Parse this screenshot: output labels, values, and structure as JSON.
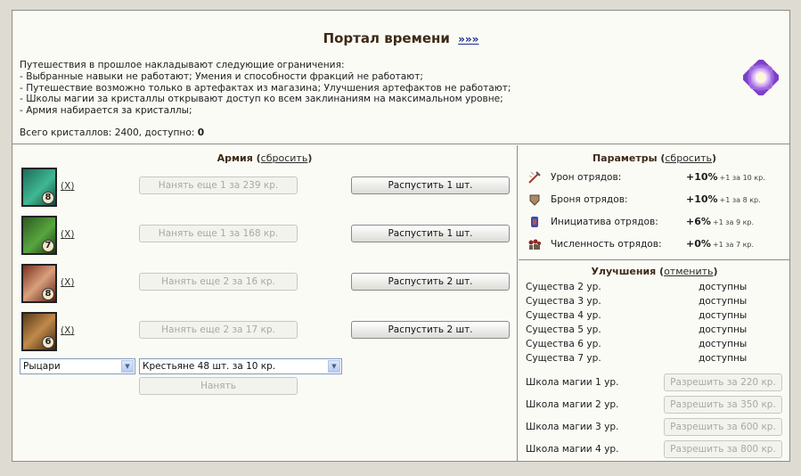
{
  "title": "Портал времени",
  "title_link": "»»»",
  "restrictions": [
    "Путешествия в прошлое накладывают следующие ограничения:",
    "- Выбранные навыки не работают; Умения и способности фракций не работают;",
    "- Путешествие возможно только в артефактах из магазина; Улучшения артефактов не работают;",
    "- Школы магии за кристаллы открывают доступ ко всем заклинаниям на максимальном уровне;",
    "- Армия набирается за кристаллы;"
  ],
  "crystals": {
    "label": "Всего кристаллов: 2400, доступно: ",
    "available": "0"
  },
  "army": {
    "title": "Армия",
    "reset_link": "сбросить",
    "units": [
      {
        "level": "8",
        "remove": "X",
        "hire_label": "Нанять еще 1 за 239 кр.",
        "dismiss_label": "Распустить 1 шт.",
        "icon": "green-dragon-icon"
      },
      {
        "level": "7",
        "remove": "X",
        "hire_label": "Нанять еще 1 за 168 кр.",
        "dismiss_label": "Распустить 1 шт.",
        "icon": "green-dragon-head-icon"
      },
      {
        "level": "8",
        "remove": "X",
        "hire_label": "Нанять еще 2 за 16 кр.",
        "dismiss_label": "Распустить 2 шт.",
        "icon": "elf-warrior-icon"
      },
      {
        "level": "6",
        "remove": "X",
        "hire_label": "Нанять еще 2 за 17 кр.",
        "dismiss_label": "Распустить 2 шт.",
        "icon": "centaur-icon"
      }
    ],
    "faction_select": "Рыцари",
    "unit_select": "Крестьяне 48 шт. за 10 кр.",
    "hire_button": "Нанять"
  },
  "parameters": {
    "title": "Параметры",
    "reset_link": "сбросить",
    "items": [
      {
        "label": "Урон отрядов:",
        "value": "+10%",
        "cost": "+1 за 10 кр.",
        "icon": "damage-icon"
      },
      {
        "label": "Броня отрядов:",
        "value": "+10%",
        "cost": "+1 за 8 кр.",
        "icon": "armor-icon"
      },
      {
        "label": "Инициатива отрядов:",
        "value": "+6%",
        "cost": "+1 за 9 кр.",
        "icon": "initiative-icon"
      },
      {
        "label": "Численность отрядов:",
        "value": "+0%",
        "cost": "+1 за 7 кр.",
        "icon": "troop-size-icon"
      }
    ]
  },
  "upgrades": {
    "title": "Улучшения",
    "cancel_link": "отменить",
    "creatures": [
      {
        "name": "Существа 2 ур.",
        "status": "доступны"
      },
      {
        "name": "Существа 3 ур.",
        "status": "доступны"
      },
      {
        "name": "Существа 4 ур.",
        "status": "доступны"
      },
      {
        "name": "Существа 5 ур.",
        "status": "доступны"
      },
      {
        "name": "Существа 6 ур.",
        "status": "доступны"
      },
      {
        "name": "Существа 7 ур.",
        "status": "доступны"
      }
    ],
    "magic": [
      {
        "name": "Школа магии 1 ур.",
        "button": "Разрешить за 220 кр."
      },
      {
        "name": "Школа магии 2 ур.",
        "button": "Разрешить за 350 кр."
      },
      {
        "name": "Школа магии 3 ур.",
        "button": "Разрешить за 600 кр."
      },
      {
        "name": "Школа магии 4 ур.",
        "button": "Разрешить за 800 кр."
      }
    ]
  },
  "colors": {
    "title": "#3d2b17",
    "link": "#1d2e86",
    "frame": "#8e8c84"
  }
}
